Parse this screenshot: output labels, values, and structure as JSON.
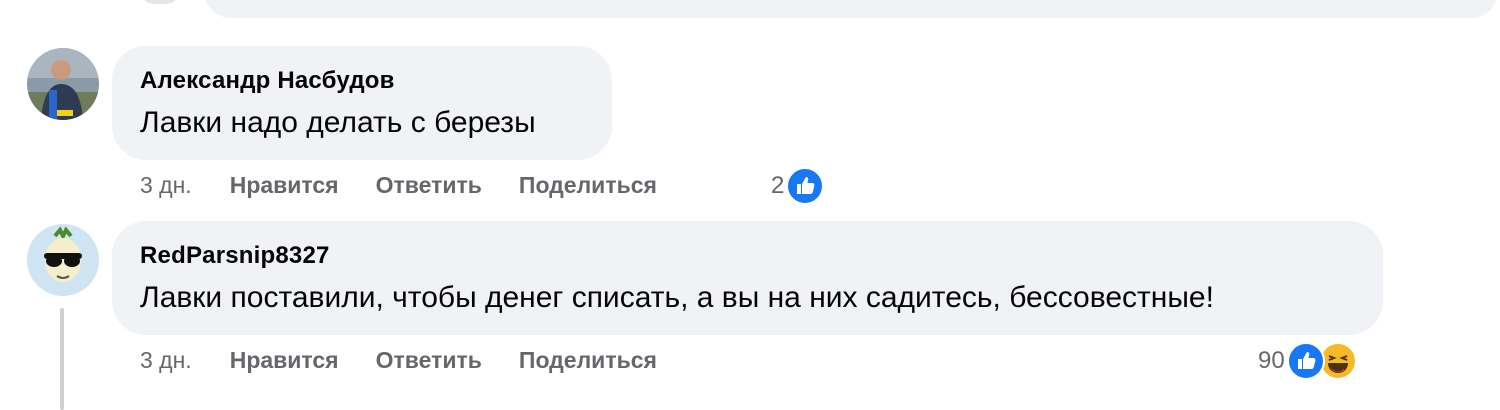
{
  "comments": [
    {
      "author": "Александр Насбудов",
      "text": "Лавки надо делать с березы",
      "time": "3 дн.",
      "like_label": "Нравится",
      "reply_label": "Ответить",
      "share_label": "Поделиться",
      "reaction_count": "2",
      "reactions": [
        "like-icon"
      ]
    },
    {
      "author": "RedParsnip8327",
      "text": "Лавки поставили, чтобы денег списать, а вы на них садитесь, бессовестные!",
      "time": "3 дн.",
      "like_label": "Нравится",
      "reply_label": "Ответить",
      "share_label": "Поделиться",
      "reaction_count": "90",
      "reactions": [
        "like-icon",
        "haha-icon"
      ]
    }
  ],
  "colors": {
    "bubble": "#f0f2f5",
    "meta": "#65676b",
    "like_blue": "#1877f2",
    "haha_yellow": "#f7b928"
  }
}
